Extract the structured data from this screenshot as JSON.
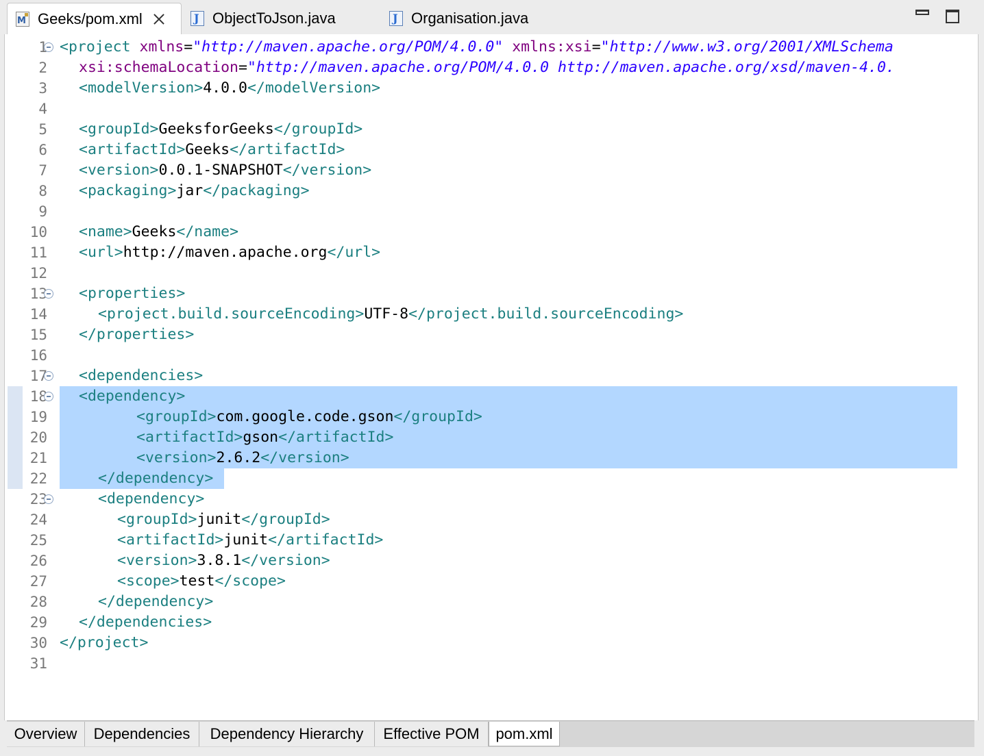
{
  "editor_tabs": [
    {
      "label": "Geeks/pom.xml",
      "icon": "maven-file-icon",
      "active": true
    },
    {
      "label": "ObjectToJson.java",
      "icon": "java-file-icon",
      "active": false
    },
    {
      "label": "Organisation.java",
      "icon": "java-file-icon",
      "active": false
    }
  ],
  "window_controls": {
    "minimize": "minimize-icon",
    "maximize": "maximize-icon"
  },
  "colors": {
    "tag": "#1b7f80",
    "attribute": "#7f007f",
    "value": "#2a00ff",
    "selection": "#b3d7ff"
  },
  "code_lines": [
    {
      "n": "1",
      "fold": true,
      "indent": 0,
      "tokens": [
        [
          "tag",
          "<project "
        ],
        [
          "attr",
          "xmlns"
        ],
        [
          "txt",
          "="
        ],
        [
          "val",
          "\"http://maven.apache.org/POM/4.0.0\""
        ],
        [
          "txt",
          " "
        ],
        [
          "attr",
          "xmlns:xsi"
        ],
        [
          "txt",
          "="
        ],
        [
          "val",
          "\"http://www.w3.org/2001/XMLSchema"
        ]
      ]
    },
    {
      "n": "2",
      "indent": 2,
      "tokens": [
        [
          "attr",
          "xsi:schemaLocation"
        ],
        [
          "txt",
          "="
        ],
        [
          "val",
          "\"http://maven.apache.org/POM/4.0.0 http://maven.apache.org/xsd/maven-4.0."
        ]
      ]
    },
    {
      "n": "3",
      "indent": 2,
      "tokens": [
        [
          "tag",
          "<modelVersion>"
        ],
        [
          "txt",
          "4.0.0"
        ],
        [
          "tag",
          "</modelVersion>"
        ]
      ]
    },
    {
      "n": "4",
      "indent": 0,
      "tokens": []
    },
    {
      "n": "5",
      "indent": 2,
      "tokens": [
        [
          "tag",
          "<groupId>"
        ],
        [
          "txt",
          "GeeksforGeeks"
        ],
        [
          "tag",
          "</groupId>"
        ]
      ]
    },
    {
      "n": "6",
      "indent": 2,
      "tokens": [
        [
          "tag",
          "<artifactId>"
        ],
        [
          "txt",
          "Geeks"
        ],
        [
          "tag",
          "</artifactId>"
        ]
      ]
    },
    {
      "n": "7",
      "indent": 2,
      "tokens": [
        [
          "tag",
          "<version>"
        ],
        [
          "txt",
          "0.0.1-SNAPSHOT"
        ],
        [
          "tag",
          "</version>"
        ]
      ]
    },
    {
      "n": "8",
      "indent": 2,
      "tokens": [
        [
          "tag",
          "<packaging>"
        ],
        [
          "txt",
          "jar"
        ],
        [
          "tag",
          "</packaging>"
        ]
      ]
    },
    {
      "n": "9",
      "indent": 0,
      "tokens": []
    },
    {
      "n": "10",
      "indent": 2,
      "tokens": [
        [
          "tag",
          "<name>"
        ],
        [
          "txt",
          "Geeks"
        ],
        [
          "tag",
          "</name>"
        ]
      ]
    },
    {
      "n": "11",
      "indent": 2,
      "tokens": [
        [
          "tag",
          "<url>"
        ],
        [
          "txt",
          "http://maven.apache.org"
        ],
        [
          "tag",
          "</url>"
        ]
      ]
    },
    {
      "n": "12",
      "indent": 0,
      "tokens": []
    },
    {
      "n": "13",
      "fold": true,
      "indent": 2,
      "tokens": [
        [
          "tag",
          "<properties>"
        ]
      ]
    },
    {
      "n": "14",
      "indent": 4,
      "tokens": [
        [
          "tag",
          "<project.build.sourceEncoding>"
        ],
        [
          "txt",
          "UTF-8"
        ],
        [
          "tag",
          "</project.build.sourceEncoding>"
        ]
      ]
    },
    {
      "n": "15",
      "indent": 2,
      "tokens": [
        [
          "tag",
          "</properties>"
        ]
      ]
    },
    {
      "n": "16",
      "indent": 0,
      "tokens": []
    },
    {
      "n": "17",
      "fold": true,
      "indent": 2,
      "tokens": [
        [
          "tag",
          "<dependencies>"
        ]
      ]
    },
    {
      "n": "18",
      "fold": true,
      "indent": 2,
      "tokens": [
        [
          "tag",
          "<dependency>"
        ]
      ]
    },
    {
      "n": "19",
      "indent": 8,
      "tokens": [
        [
          "tag",
          "<groupId>"
        ],
        [
          "txt",
          "com.google.code.gson"
        ],
        [
          "tag",
          "</groupId>"
        ]
      ]
    },
    {
      "n": "20",
      "indent": 8,
      "tokens": [
        [
          "tag",
          "<artifactId>"
        ],
        [
          "txt",
          "gson"
        ],
        [
          "tag",
          "</artifactId>"
        ]
      ]
    },
    {
      "n": "21",
      "indent": 8,
      "tokens": [
        [
          "tag",
          "<version>"
        ],
        [
          "txt",
          "2.6.2"
        ],
        [
          "tag",
          "</version>"
        ]
      ]
    },
    {
      "n": "22",
      "indent": 4,
      "tokens": [
        [
          "tag",
          "</dependency>"
        ]
      ]
    },
    {
      "n": "23",
      "fold": true,
      "indent": 4,
      "tokens": [
        [
          "tag",
          "<dependency>"
        ]
      ]
    },
    {
      "n": "24",
      "indent": 6,
      "tokens": [
        [
          "tag",
          "<groupId>"
        ],
        [
          "txt",
          "junit"
        ],
        [
          "tag",
          "</groupId>"
        ]
      ]
    },
    {
      "n": "25",
      "indent": 6,
      "tokens": [
        [
          "tag",
          "<artifactId>"
        ],
        [
          "txt",
          "junit"
        ],
        [
          "tag",
          "</artifactId>"
        ]
      ]
    },
    {
      "n": "26",
      "indent": 6,
      "tokens": [
        [
          "tag",
          "<version>"
        ],
        [
          "txt",
          "3.8.1"
        ],
        [
          "tag",
          "</version>"
        ]
      ]
    },
    {
      "n": "27",
      "indent": 6,
      "tokens": [
        [
          "tag",
          "<scope>"
        ],
        [
          "txt",
          "test"
        ],
        [
          "tag",
          "</scope>"
        ]
      ]
    },
    {
      "n": "28",
      "indent": 4,
      "tokens": [
        [
          "tag",
          "</dependency>"
        ]
      ]
    },
    {
      "n": "29",
      "indent": 2,
      "tokens": [
        [
          "tag",
          "</dependencies>"
        ]
      ]
    },
    {
      "n": "30",
      "indent": 0,
      "tokens": [
        [
          "tag",
          "</project>"
        ]
      ]
    },
    {
      "n": "31",
      "indent": 0,
      "tokens": []
    }
  ],
  "selection": {
    "from_line": "18",
    "to_line": "22"
  },
  "bottom_tabs": [
    {
      "label": "Overview",
      "active": false
    },
    {
      "label": "Dependencies",
      "active": false
    },
    {
      "label": "Dependency Hierarchy",
      "active": false
    },
    {
      "label": "Effective POM",
      "active": false
    },
    {
      "label": "pom.xml",
      "active": true
    }
  ]
}
